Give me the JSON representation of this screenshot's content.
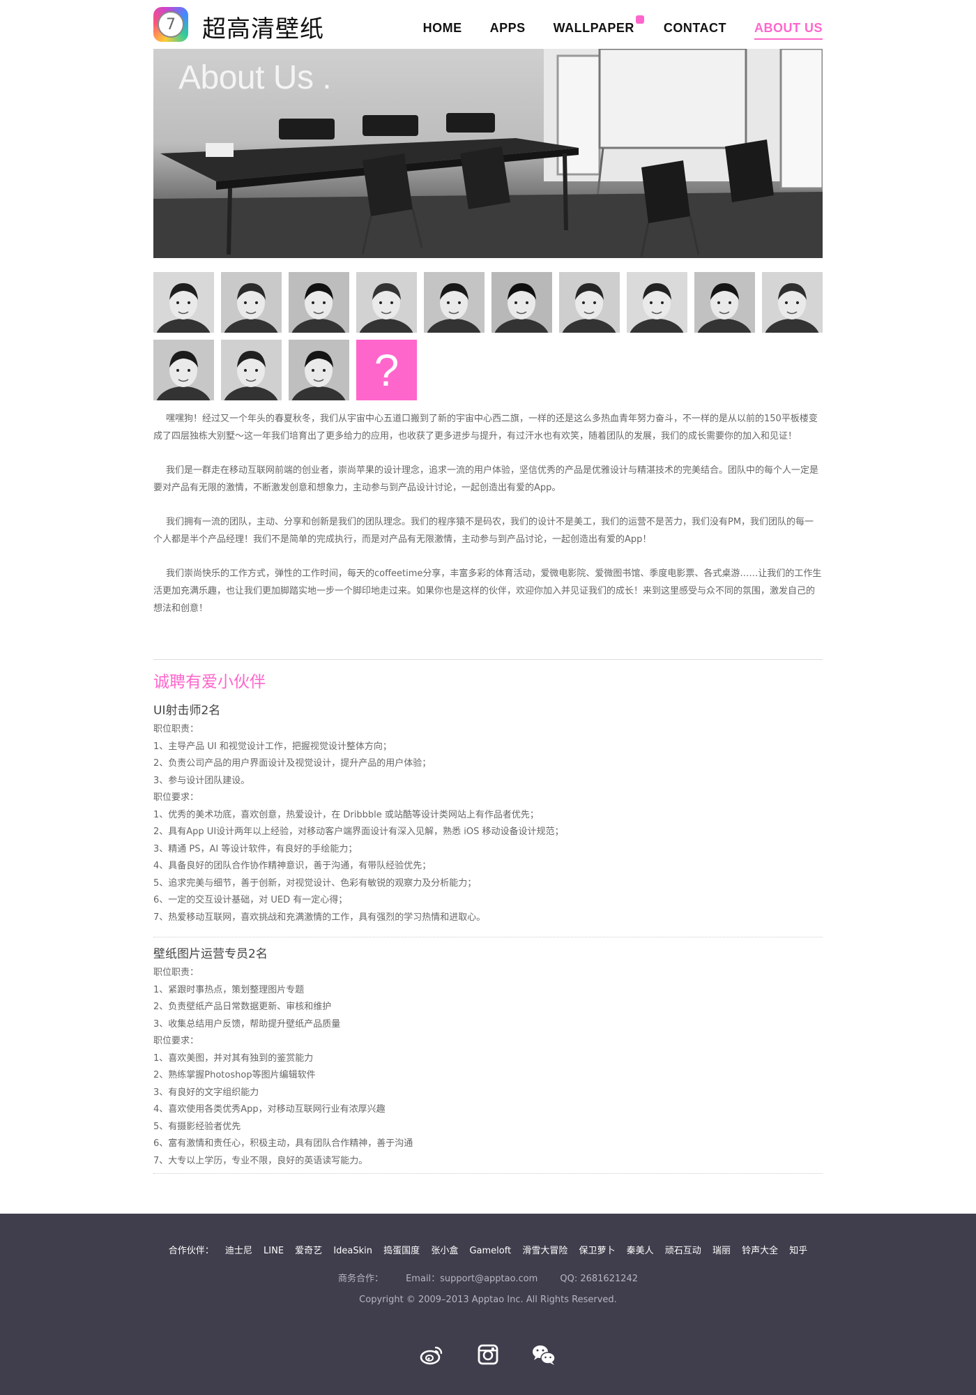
{
  "brand": {
    "name": "超高清壁纸",
    "logo_glyph": "7"
  },
  "nav": {
    "items": [
      {
        "label": "HOME"
      },
      {
        "label": "APPS"
      },
      {
        "label": "WALLPAPER"
      },
      {
        "label": "CONTACT"
      },
      {
        "label": "ABOUT US"
      }
    ]
  },
  "hero": {
    "title": "About Us ."
  },
  "team": {
    "placeholder_glyph": "?"
  },
  "about": {
    "paragraphs": [
      "嘿嘿狗！经过又一个年头的春夏秋冬，我们从宇宙中心五道口搬到了新的宇宙中心西二旗，一样的还是这么多热血青年努力奋斗，不一样的是从以前的150平板楼变成了四层独栋大别墅～这一年我们培育出了更多给力的应用，也收获了更多进步与提升，有过汗水也有欢笑，随着团队的发展，我们的成长需要你的加入和见证！",
      "我们是一群走在移动互联网前端的创业者，崇尚苹果的设计理念，追求一流的用户体验，坚信优秀的产品是优雅设计与精湛技术的完美结合。团队中的每个人一定是要对产品有无限的激情，不断激发创意和想象力，主动参与到产品设计讨论，一起创造出有爱的App。",
      "我们拥有一流的团队，主动、分享和创新是我们的团队理念。我们的程序猿不是码农，我们的设计不是美工，我们的运营不是苦力，我们没有PM，我们团队的每一个人都是半个产品经理！我们不是简单的完成执行，而是对产品有无限激情，主动参与到产品讨论，一起创造出有爱的App！",
      "我们崇尚快乐的工作方式，弹性的工作时间，每天的coffeetime分享，丰富多彩的体育活动，爱微电影院、爱微图书馆、季度电影票、各式桌游……让我们的工作生活更加充满乐趣，也让我们更加脚踏实地一步一个脚印地走过来。如果你也是这样的伙伴，欢迎你加入并见证我们的成长！来到这里感受与众不同的氛围，激发自己的想法和创意！"
    ]
  },
  "recruit": {
    "title": "诚聘有爱小伙伴",
    "jobs": [
      {
        "title": "UI射击师2名",
        "lines": [
          "职位职责：",
          "1、主导产品 UI 和视觉设计工作，把握视觉设计整体方向；",
          "2、负责公司产品的用户界面设计及视觉设计，提升产品的用户体验；",
          "3、参与设计团队建设。",
          "职位要求：",
          "1、优秀的美术功底，喜欢创意，热爱设计，在 Dribbble 或站酷等设计类网站上有作品者优先；",
          "2、具有App UI设计两年以上经验，对移动客户端界面设计有深入见解，熟悉 iOS 移动设备设计规范；",
          "3、精通 PS，AI 等设计软件，有良好的手绘能力；",
          "4、具备良好的团队合作协作精神意识，善于沟通，有带队经验优先；",
          "5、追求完美与细节，善于创新，对视觉设计、色彩有敏锐的观察力及分析能力；",
          "6、一定的交互设计基础，对 UED 有一定心得；",
          "7、热爱移动互联网，喜欢挑战和充满激情的工作，具有强烈的学习热情和进取心。"
        ]
      },
      {
        "title": "壁纸图片运营专员2名",
        "lines": [
          "职位职责：",
          "1、紧跟时事热点，策划整理图片专题",
          "2、负责壁纸产品日常数据更新、审核和维护",
          "3、收集总结用户反馈，帮助提升壁纸产品质量",
          "职位要求：",
          "1、喜欢美图，并对其有独到的鉴赏能力",
          "2、熟练掌握Photoshop等图片编辑软件",
          "3、有良好的文字组织能力",
          "4、喜欢使用各类优秀App，对移动互联网行业有浓厚兴趣",
          "5、有摄影经验者优先",
          "6、富有激情和责任心，积极主动，具有团队合作精神，善于沟通",
          "7、大专以上学历，专业不限，良好的英语读写能力。"
        ]
      }
    ]
  },
  "footer": {
    "partners_label": "合作伙伴：",
    "partners": [
      "迪士尼",
      "LINE",
      "爱奇艺",
      "IdeaSkin",
      "捣蛋国度",
      "张小盒",
      "Gameloft",
      "滑雪大冒险",
      "保卫萝卜",
      "秦美人",
      "顽石互动",
      "瑞丽",
      "铃声大全",
      "知乎"
    ],
    "business_label": "商务合作：",
    "email": "Email：support@apptao.com",
    "qq": "QQ: 2681621242",
    "copyright": "Copyright © 2009–2013 Apptao Inc. All Rights Reserved.",
    "social": [
      "weibo-icon",
      "instagram-icon",
      "wechat-icon"
    ]
  },
  "colors": {
    "accent": "#ff66cc",
    "footer_bg": "#403e4c",
    "text": "#666666"
  }
}
